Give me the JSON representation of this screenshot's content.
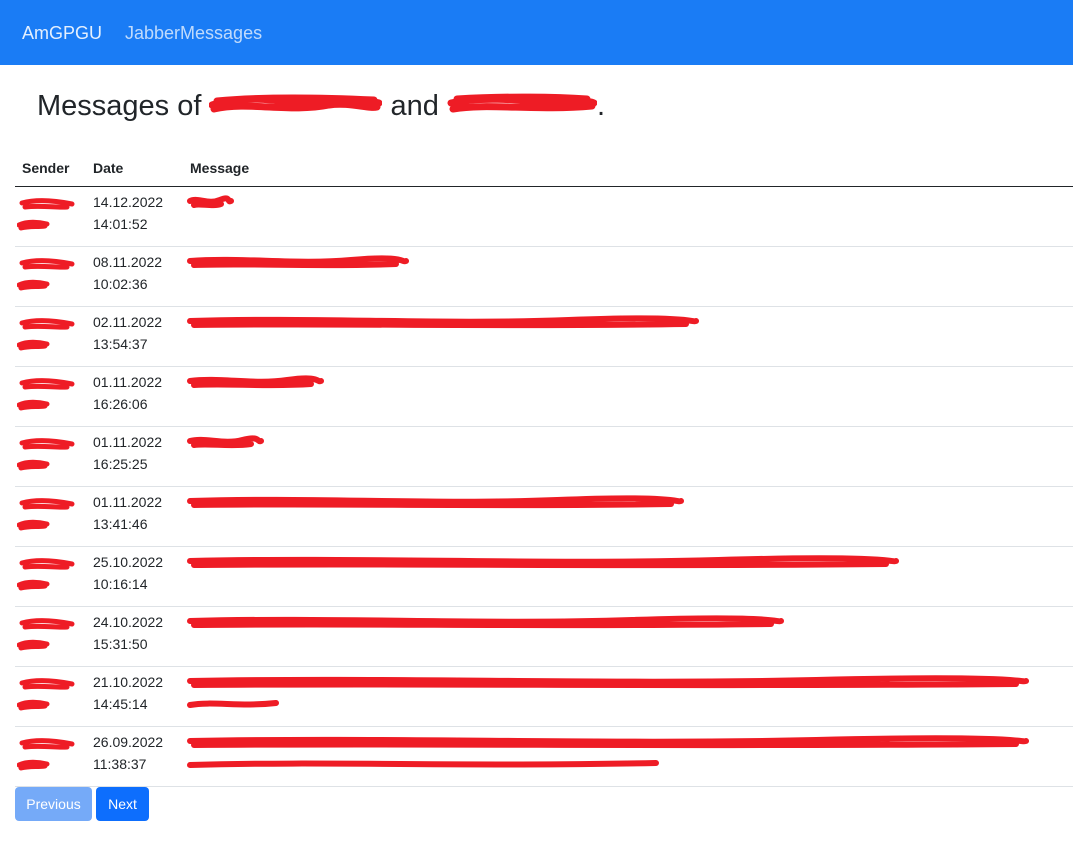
{
  "navbar": {
    "brand": "AmGPGU",
    "link": "JabberMessages",
    "bg_color": "#1a7cf5"
  },
  "page": {
    "title_prefix": "Messages of",
    "title_and": "and",
    "title_end": "."
  },
  "table": {
    "headers": {
      "sender": "Sender",
      "date": "Date",
      "message": "Message"
    },
    "rows": [
      {
        "date": "14.12.2022",
        "time": "14:01:52"
      },
      {
        "date": "08.11.2022",
        "time": "10:02:36"
      },
      {
        "date": "02.11.2022",
        "time": "13:54:37"
      },
      {
        "date": "01.11.2022",
        "time": "16:26:06"
      },
      {
        "date": "01.11.2022",
        "time": "16:25:25"
      },
      {
        "date": "01.11.2022",
        "time": "13:41:46"
      },
      {
        "date": "25.10.2022",
        "time": "10:16:14"
      },
      {
        "date": "24.10.2022",
        "time": "15:31:50"
      },
      {
        "date": "21.10.2022",
        "time": "14:45:14"
      },
      {
        "date": "26.09.2022",
        "time": "11:38:37"
      }
    ]
  },
  "pagination": {
    "previous": "Previous",
    "next": "Next"
  },
  "colors": {
    "redaction": "#ee1c25",
    "next_button": "#0d6efd",
    "prev_button": "#75aaf8"
  }
}
